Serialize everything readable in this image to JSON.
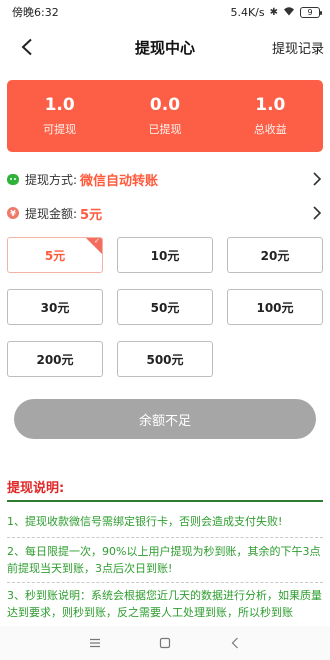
{
  "status_bar": {
    "time": "傍晚6:32",
    "network_speed": "5.4K/s",
    "battery": "9"
  },
  "header": {
    "title": "提现中心",
    "right_link": "提现记录"
  },
  "summary": {
    "items": [
      {
        "value": "1.0",
        "label": "可提现"
      },
      {
        "value": "0.0",
        "label": "已提现"
      },
      {
        "value": "1.0",
        "label": "总收益"
      }
    ]
  },
  "method": {
    "label": "提现方式:",
    "value": "微信自动转账"
  },
  "amount": {
    "label": "提现金额:",
    "value": "5元"
  },
  "options": [
    "5元",
    "10元",
    "20元",
    "30元",
    "50元",
    "100元",
    "200元",
    "500元"
  ],
  "selected_option": "5元",
  "submit": {
    "label": "余额不足"
  },
  "notes": {
    "title": "提现说明:",
    "items": [
      "1、提现收款微信号需绑定银行卡，否则会造成支付失败!",
      "2、每日限提一次，90%以上用户提现为秒到账，其余的下午3点前提现当天到账，3点后次日到账!",
      "3、秒到账说明：系统会根据您近几天的数据进行分析，如果质量达到要求，则秒到账，反之需要人工处理到账，所以秒到账"
    ]
  },
  "colors": {
    "accent": "#fc5f45",
    "notes_green": "#2e9d2f",
    "notes_title": "#e02828",
    "disabled_button": "#a6a6a6"
  }
}
